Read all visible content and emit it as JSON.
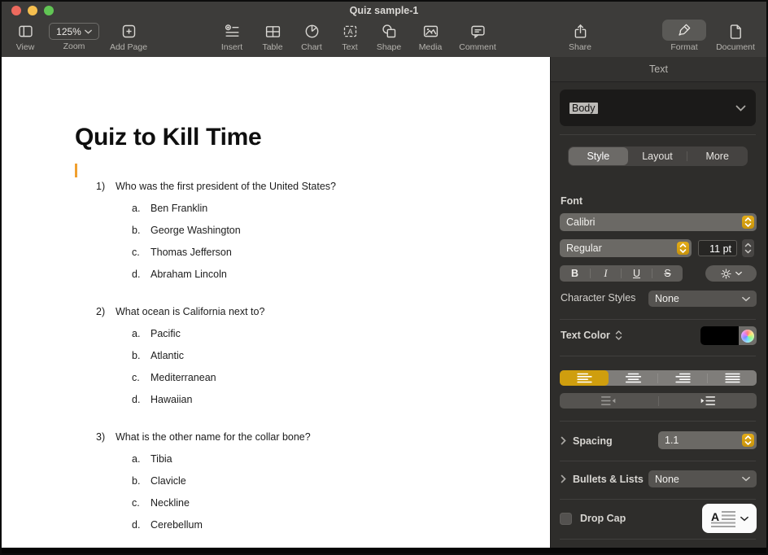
{
  "window": {
    "title": "Quiz sample-1"
  },
  "toolbar": {
    "zoom_value": "125%",
    "items": [
      {
        "label": "View"
      },
      {
        "label": "Zoom"
      },
      {
        "label": "Add Page"
      },
      {
        "label": "Insert"
      },
      {
        "label": "Table"
      },
      {
        "label": "Chart"
      },
      {
        "label": "Text"
      },
      {
        "label": "Shape"
      },
      {
        "label": "Media"
      },
      {
        "label": "Comment"
      },
      {
        "label": "Share"
      },
      {
        "label": "Format"
      },
      {
        "label": "Document"
      }
    ]
  },
  "document": {
    "title": "Quiz to Kill Time",
    "questions": [
      {
        "number": "1)",
        "text": "Who was the first president of the United States?",
        "options": [
          {
            "letter": "a.",
            "text": "Ben Franklin"
          },
          {
            "letter": "b.",
            "text": "George Washington"
          },
          {
            "letter": "c.",
            "text": "Thomas Jefferson"
          },
          {
            "letter": "d.",
            "text": "Abraham Lincoln"
          }
        ]
      },
      {
        "number": "2)",
        "text": "What ocean is California next to?",
        "options": [
          {
            "letter": "a.",
            "text": "Pacific"
          },
          {
            "letter": "b.",
            "text": "Atlantic"
          },
          {
            "letter": "c.",
            "text": "Mediterranean"
          },
          {
            "letter": "d.",
            "text": "Hawaiian"
          }
        ]
      },
      {
        "number": "3)",
        "text": "What is the other name for the collar bone?",
        "options": [
          {
            "letter": "a.",
            "text": "Tibia"
          },
          {
            "letter": "b.",
            "text": "Clavicle"
          },
          {
            "letter": "c.",
            "text": "Neckline"
          },
          {
            "letter": "d.",
            "text": "Cerebellum"
          }
        ]
      }
    ]
  },
  "sidebar": {
    "header": "Text",
    "paragraph_style": "Body",
    "tabs": {
      "style": "Style",
      "layout": "Layout",
      "more": "More"
    },
    "font": {
      "section_label": "Font",
      "family": "Calibri",
      "typeface": "Regular",
      "size": "11 pt",
      "bold": "B",
      "italic": "I",
      "underline": "U",
      "strikethrough": "S"
    },
    "character_styles": {
      "label": "Character Styles",
      "value": "None"
    },
    "text_color": {
      "label": "Text Color"
    },
    "spacing": {
      "label": "Spacing",
      "value": "1.1"
    },
    "bullets": {
      "label": "Bullets & Lists",
      "value": "None"
    },
    "drop_cap": {
      "label": "Drop Cap"
    }
  },
  "icons": {
    "view": "sidebar-panel",
    "add-page": "plus-in-box",
    "insert": "plus-list",
    "table": "grid",
    "chart": "pie-chart",
    "text": "letter-A-box",
    "shape": "circle-square",
    "media": "photo",
    "comment": "speech-bubble",
    "share": "box-up-arrow",
    "format": "paintbrush",
    "document": "page",
    "gear": "settings-gear",
    "color-wheel": "rainbow-circle",
    "chevron-down": "v",
    "up-down-stepper": "^v"
  },
  "colors": {
    "accent": "#cf9e0e",
    "cursor": "#f0a030",
    "tl-red": "#ed6a5e",
    "tl-yellow": "#f5bf4f",
    "tl-green": "#61c554"
  }
}
